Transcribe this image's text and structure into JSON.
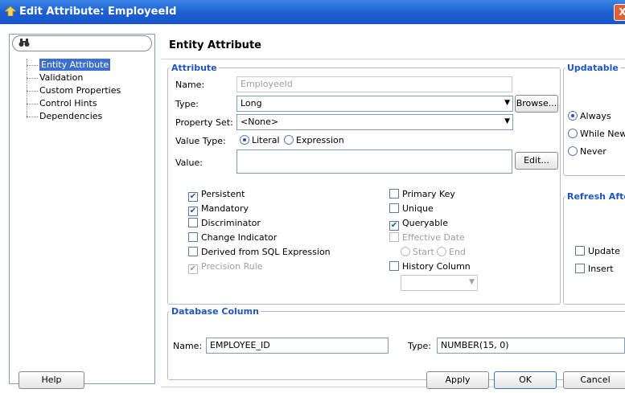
{
  "window": {
    "title": "Edit Attribute: EmployeeId",
    "close_glyph": "X"
  },
  "nav": {
    "search_icon": "binoculars-icon",
    "items": [
      {
        "label": "Entity Attribute",
        "selected": true
      },
      {
        "label": "Validation"
      },
      {
        "label": "Custom Properties"
      },
      {
        "label": "Control Hints"
      },
      {
        "label": "Dependencies"
      }
    ]
  },
  "page": {
    "title": "Entity Attribute"
  },
  "attribute": {
    "legend": "Attribute",
    "name_label": "Name:",
    "name_value": "EmployeeId",
    "type_label": "Type:",
    "type_value": "Long",
    "browse_label": "Browse...",
    "property_set_label": "Property Set:",
    "property_set_value": "<None>",
    "value_type_label": "Value Type:",
    "value_type_options": [
      "Literal",
      "Expression"
    ],
    "value_label": "Value:",
    "value_value": "",
    "edit_label": "Edit...",
    "checks_left": [
      {
        "label": "Persistent",
        "checked": true
      },
      {
        "label": "Mandatory",
        "checked": true
      },
      {
        "label": "Discriminator",
        "checked": false
      },
      {
        "label": "Change Indicator",
        "checked": false
      },
      {
        "label": "Derived from SQL Expression",
        "checked": false
      },
      {
        "label": "Precision Rule",
        "checked": true,
        "disabled": true
      }
    ],
    "checks_right": [
      {
        "label": "Primary Key",
        "checked": false
      },
      {
        "label": "Unique",
        "checked": false
      },
      {
        "label": "Queryable",
        "checked": true
      },
      {
        "label": "Effective Date",
        "checked": false,
        "disabled": true
      }
    ],
    "effective_options": [
      "Start",
      "End"
    ],
    "history_label": "History Column",
    "history_value": ""
  },
  "updatable": {
    "legend": "Updatable",
    "options": [
      "Always",
      "While New",
      "Never"
    ]
  },
  "refresh": {
    "legend": "Refresh Afte",
    "options": [
      "Update",
      "Insert"
    ]
  },
  "db_column": {
    "legend": "Database Column",
    "name_label": "Name:",
    "name_value": "EMPLOYEE_ID",
    "type_label": "Type:",
    "type_value": "NUMBER(15, 0)"
  },
  "footer": {
    "help": "Help",
    "apply": "Apply",
    "ok": "OK",
    "cancel": "Cancel"
  },
  "colors": {
    "accent": "#1f56c2",
    "title_bar": "#1e5fd2",
    "selection": "#3d6fcf"
  }
}
